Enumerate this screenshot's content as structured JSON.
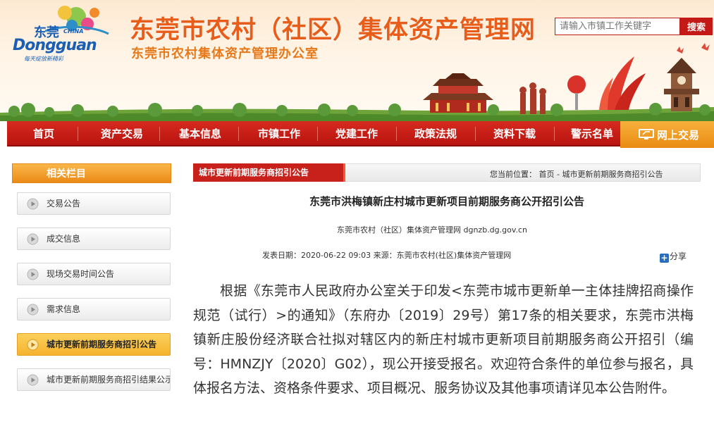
{
  "header": {
    "logo_cn": "东莞",
    "logo_china": "CHINA",
    "logo_en": "Dongguan",
    "logo_slogan": "每天绽放新精彩",
    "site_title": "东莞市农村（社区）集体资产管理网",
    "site_subtitle": "东莞市农村集体资产管理办公室",
    "search_placeholder": "请输入市镇工作关键字",
    "search_button": "搜索"
  },
  "nav": {
    "items": [
      "首页",
      "资产交易",
      "基本信息",
      "市镇工作",
      "党建工作",
      "政策法规",
      "资料下载",
      "警示名单"
    ],
    "online_trade": "网上交易"
  },
  "sidebar": {
    "title": "相关栏目",
    "items": [
      "交易公告",
      "成交信息",
      "现场交易时间公告",
      "需求信息",
      "城市更新前期服务商招引公告",
      "城市更新前期服务商招引结果公示"
    ],
    "active_index": 4
  },
  "main": {
    "tab_label": "城市更新前期服务商招引公告",
    "breadcrumb": "您当前位置： 首页 - 城市更新前期服务商招引公告",
    "title": "东莞市洪梅镇新庄村城市更新项目前期服务商公开招引公告",
    "org_line": "东莞市农村（社区）集体资产管理网    dgnzb.dg.gov.cn",
    "meta_line": "发表日期：2020-06-22 09:03     来源：东莞市农村(社区)集体资产管理网",
    "share": "分享",
    "body": "根据《东莞市人民政府办公室关于印发<东莞市城市更新单一主体挂牌招商操作规范（试行）>的通知》（东府办〔2019〕29号）第17条的相关要求，东莞市洪梅镇新庄股份经济联合社拟对辖区内的新庄村城市更新项目前期服务商公开招引（编号：HMNZJY〔2020〕G02），现公开接受报名。欢迎符合条件的单位参与报名，具体报名方法、资格条件要求、项目概况、服务协议及其他事项请详见本公告附件。"
  },
  "colors": {
    "brand_red": "#c41a17",
    "title_orange": "#e85d1a",
    "nav_orange": "#eb8a16"
  }
}
